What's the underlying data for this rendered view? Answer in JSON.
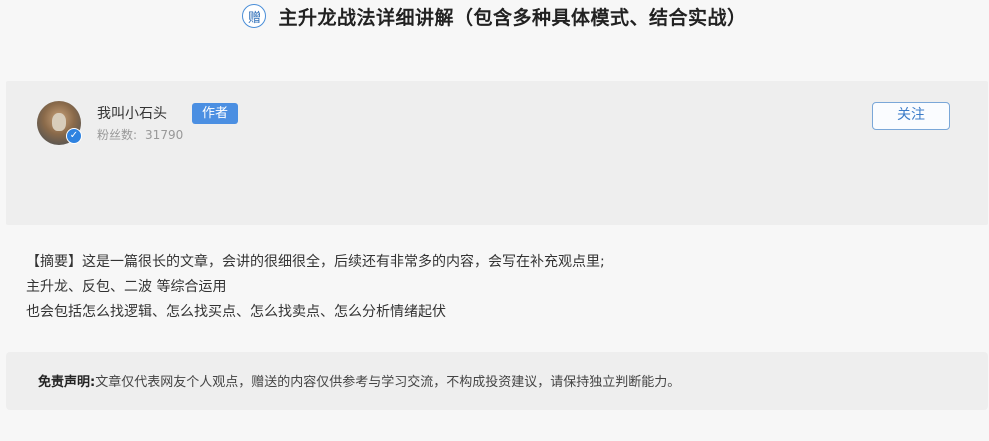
{
  "header": {
    "gift_badge": "赠",
    "title": "主升龙战法详细讲解（包含多种具体模式、结合实战）"
  },
  "author": {
    "name": "我叫小石头",
    "tag": "作者",
    "fans_label": "粉丝数:",
    "fans_count": "31790",
    "follow_label": "关注",
    "verified_icon": "verified-check-icon"
  },
  "summary": {
    "line1": "【摘要】这是一篇很长的文章，会讲的很细很全，后续还有非常多的内容，会写在补充观点里;",
    "line2": "主升龙、反包、二波 等综合运用",
    "line3": "也会包括怎么找逻辑、怎么找买点、怎么找卖点、怎么分析情绪起伏"
  },
  "disclaimer": {
    "label": "免责声明:",
    "text": "文章仅代表网友个人观点，赠送的内容仅供参考与学习交流，不构成投资建议，请保持独立判断能力。"
  },
  "colors": {
    "accent": "#4b8fe2",
    "card_bg": "#eeeeee",
    "page_bg": "#f7f7f7"
  }
}
